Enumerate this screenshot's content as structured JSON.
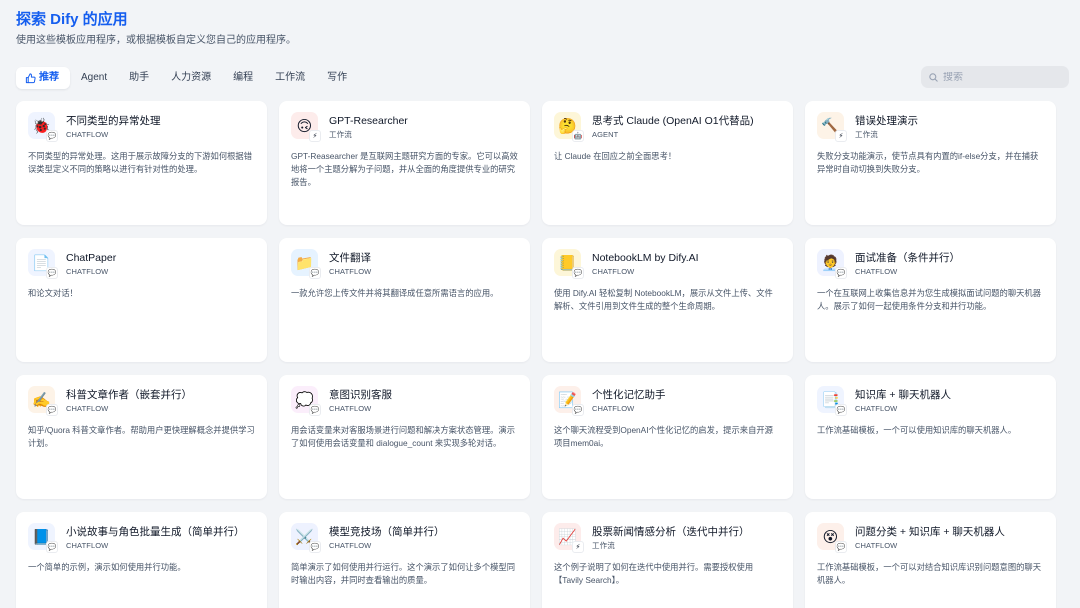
{
  "header": {
    "title": "探索 Dify 的应用",
    "subtitle": "使用这些模板应用程序，或根据模板自定义您自己的应用程序。"
  },
  "tabs": [
    {
      "label": "推荐",
      "icon": "thumbs-up-icon",
      "active": true
    },
    {
      "label": "Agent"
    },
    {
      "label": "助手"
    },
    {
      "label": "人力资源"
    },
    {
      "label": "编程"
    },
    {
      "label": "工作流"
    },
    {
      "label": "写作"
    }
  ],
  "search": {
    "placeholder": "搜索",
    "icon": "search-icon"
  },
  "colors": {
    "accent": "#155eef",
    "page_bg": "#f2f4f7",
    "card_bg": "#ffffff"
  },
  "cards": [
    {
      "title": "不同类型的异常处理",
      "mode": "CHATFLOW",
      "icon": "🐞",
      "icon_bg": "#eff4ff",
      "badge": "chatflow-badge-icon",
      "description": "不同类型的异常处理。这用于展示故障分支的下游如何根据错误类型定义不同的策略以进行有针对性的处理。"
    },
    {
      "title": "GPT-Researcher",
      "mode": "工作流",
      "icon": "🙃",
      "icon_bg": "#fdeceb",
      "badge": "workflow-badge-icon",
      "description": "GPT-Reasearcher 是互联网主题研究方面的专家。它可以高效地将一个主题分解为子问题，并从全面的角度提供专业的研究报告。"
    },
    {
      "title": "思考式 Claude (OpenAI O1代替品)",
      "mode": "AGENT",
      "icon": "🤔",
      "icon_bg": "#fdf6d8",
      "badge": "agent-badge-icon",
      "description": "让 Claude 在回应之前全面思考！"
    },
    {
      "title": "错误处理演示",
      "mode": "工作流",
      "icon": "🔨",
      "icon_bg": "#fdf3e7",
      "badge": "workflow-badge-icon",
      "description": "失败分支功能演示，使节点具有内置的if-else分支，并在捕获异常时自动切换到失败分支。"
    },
    {
      "title": "ChatPaper",
      "mode": "CHATFLOW",
      "icon": "📄",
      "icon_bg": "#eff4ff",
      "badge": "chatflow-badge-icon",
      "description": "和论文对话！"
    },
    {
      "title": "文件翻译",
      "mode": "CHATFLOW",
      "icon": "📁",
      "icon_bg": "#e6f3ff",
      "badge": "chatflow-badge-icon",
      "description": "一款允许您上传文件并将其翻译成任意所需语言的应用。"
    },
    {
      "title": "NotebookLM by Dify.AI",
      "mode": "CHATFLOW",
      "icon": "📒",
      "icon_bg": "#fdf6d8",
      "badge": "chatflow-badge-icon",
      "description": "使用 Dify.AI 轻松复制 NotebookLM，展示从文件上传、文件解析、文件引用到文件生成的整个生命周期。"
    },
    {
      "title": "面试准备（条件并行）",
      "mode": "CHATFLOW",
      "icon": "🧑‍💼",
      "icon_bg": "#eef2ff",
      "badge": "chatflow-badge-icon",
      "description": "一个在互联网上收集信息并为您生成模拟面试问题的聊天机器人。展示了如何一起使用条件分支和并行功能。"
    },
    {
      "title": "科普文章作者（嵌套并行）",
      "mode": "CHATFLOW",
      "icon": "✍️",
      "icon_bg": "#fdf3e7",
      "badge": "chatflow-badge-icon",
      "description": "知乎/Quora 科普文章作者。帮助用户更快理解概念并提供学习计划。"
    },
    {
      "title": "意图识别客服",
      "mode": "CHATFLOW",
      "icon": "💭",
      "icon_bg": "#fbeefb",
      "badge": "chatflow-badge-icon",
      "description": "用会话变量来对客服场景进行问题和解决方案状态管理。演示了如何使用会话变量和 dialogue_count 来实现多轮对话。"
    },
    {
      "title": "个性化记忆助手",
      "mode": "CHATFLOW",
      "icon": "📝",
      "icon_bg": "#fdf0ea",
      "badge": "chatflow-badge-icon",
      "description": "这个聊天流程受到OpenAI个性化记忆的启发，提示来自开源项目mem0ai。"
    },
    {
      "title": "知识库 + 聊天机器人",
      "mode": "CHATFLOW",
      "icon": "📑",
      "icon_bg": "#eff4ff",
      "badge": "chatflow-badge-icon",
      "description": "工作流基础模板，一个可以使用知识库的聊天机器人。"
    },
    {
      "title": "小说故事与角色批量生成（简单并行）",
      "mode": "CHATFLOW",
      "icon": "📘",
      "icon_bg": "#eff4ff",
      "badge": "chatflow-badge-icon",
      "description": "一个简单的示例，演示如何使用并行功能。"
    },
    {
      "title": "模型竞技场（简单并行）",
      "mode": "CHATFLOW",
      "icon": "⚔️",
      "icon_bg": "#eef2ff",
      "badge": "chatflow-badge-icon",
      "description": "简单演示了如何使用并行运行。这个演示了如何让多个模型同时输出内容，并同时查看输出的质量。"
    },
    {
      "title": "股票新闻情感分析（迭代中并行）",
      "mode": "工作流",
      "icon": "📈",
      "icon_bg": "#fdeceb",
      "badge": "workflow-badge-icon",
      "description": "这个例子说明了如何在迭代中使用并行。需要授权使用【Tavily Search】。"
    },
    {
      "title": "问题分类 + 知识库 + 聊天机器人",
      "mode": "CHATFLOW",
      "icon": "😵",
      "icon_bg": "#fdf0ea",
      "badge": "chatflow-badge-icon",
      "description": "工作流基础模板，一个可以对结合知识库识别问题意图的聊天机器人。"
    }
  ]
}
